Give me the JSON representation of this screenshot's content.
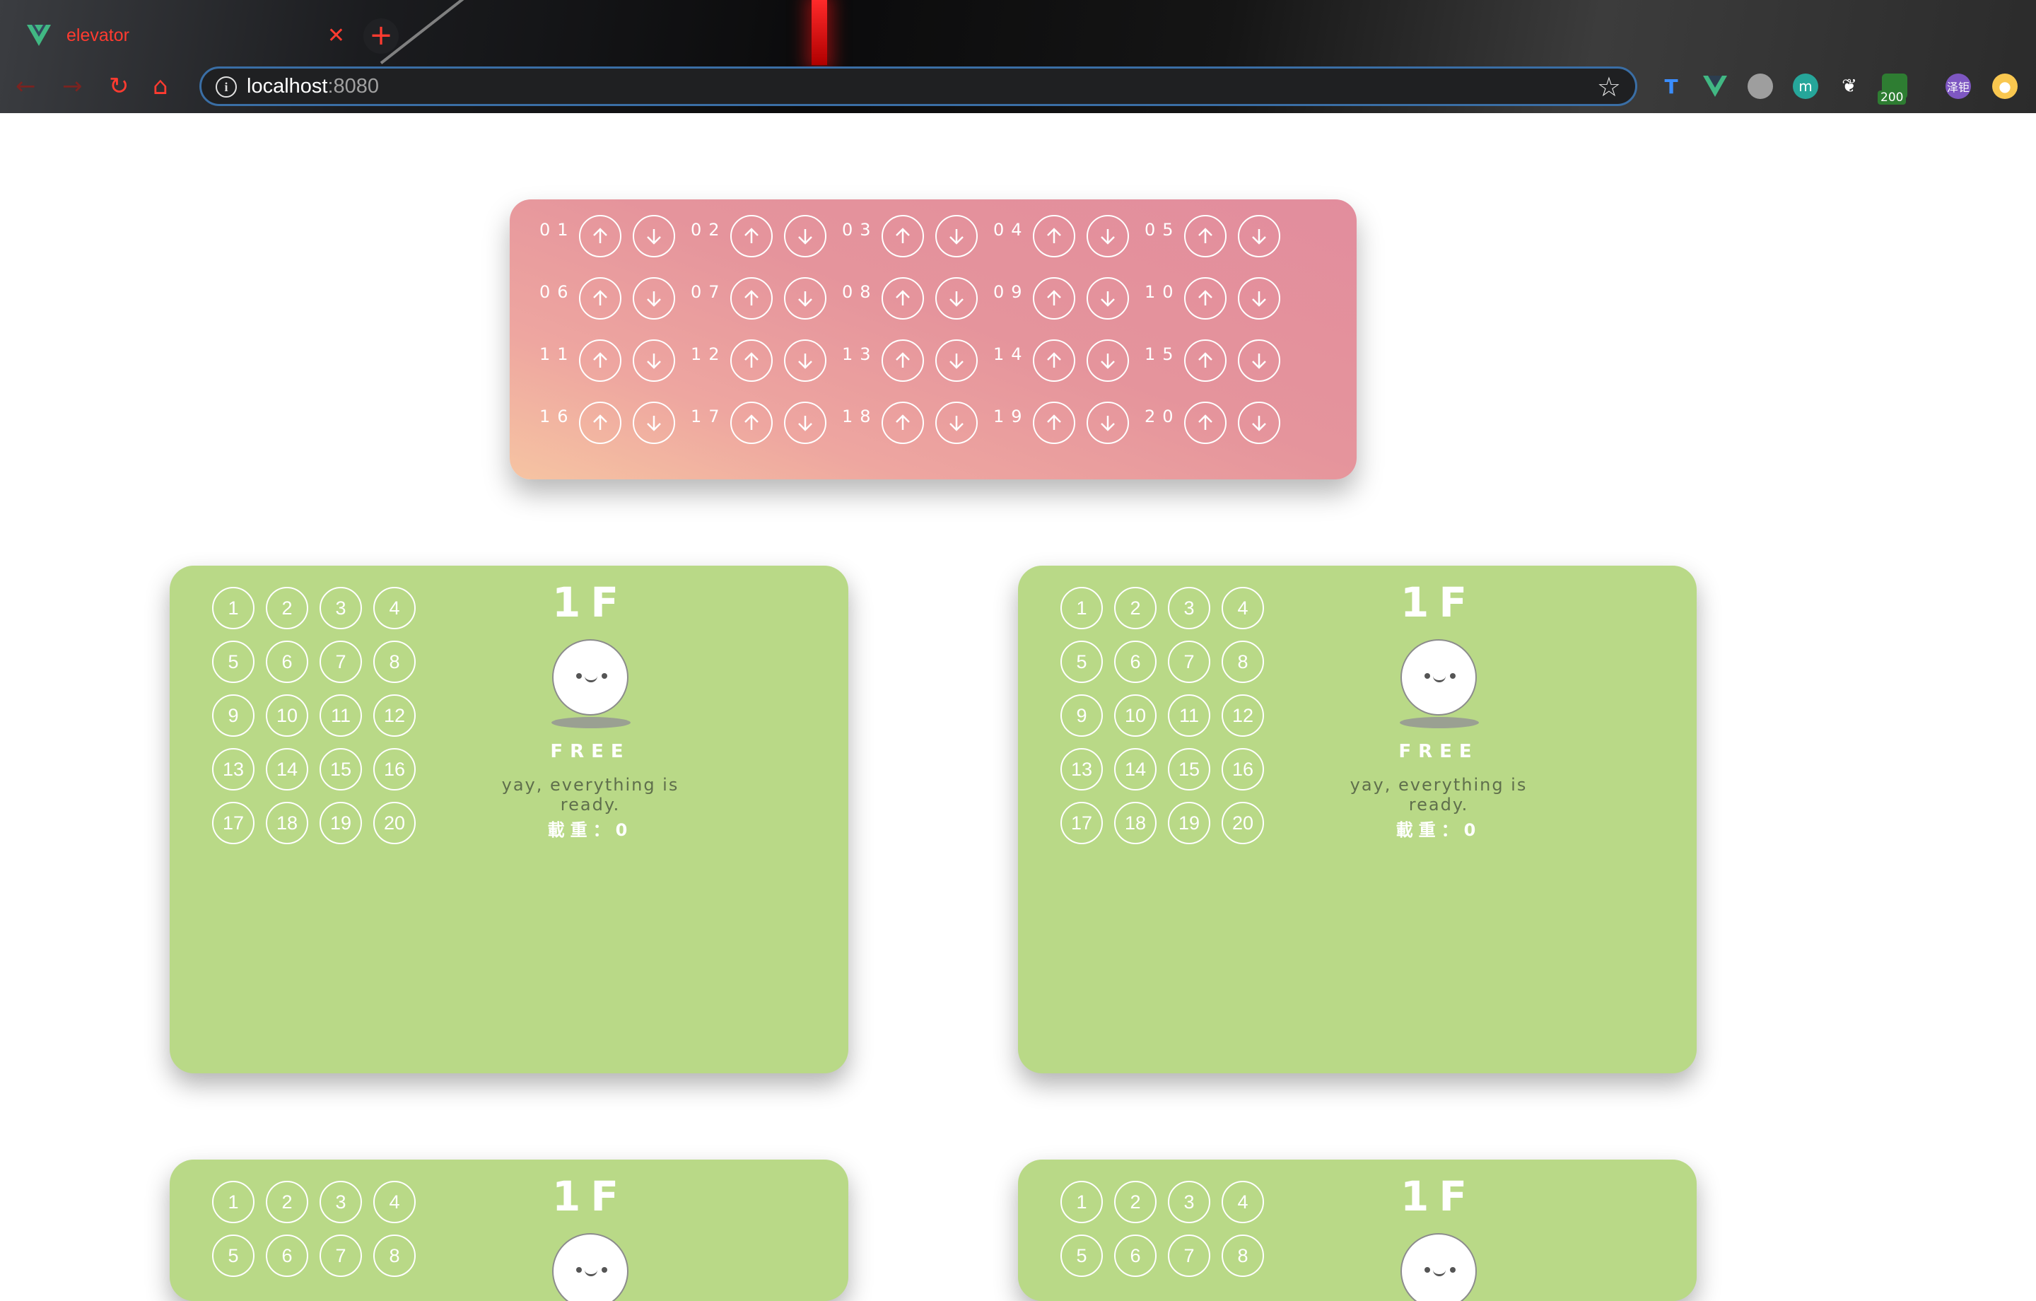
{
  "browser": {
    "tab_title": "elevator",
    "tab_close": "✕",
    "new_tab": "+",
    "url_host": "localhost",
    "url_port": ":8080",
    "extensions": [
      "tampermonkey-icon",
      "vue-devtools-icon",
      "circle-ext-icon",
      "m-ext-icon",
      "gitee-icon",
      "counter-ext-icon",
      "avatar-icon",
      "notification-icon"
    ],
    "ext_badge": "200",
    "avatar_text": "泽钜"
  },
  "call_panel": {
    "floors": [
      "01",
      "02",
      "03",
      "04",
      "05",
      "06",
      "07",
      "08",
      "09",
      "10",
      "11",
      "12",
      "13",
      "14",
      "15",
      "16",
      "17",
      "18",
      "19",
      "20"
    ]
  },
  "cars": [
    {
      "floor_display": "1F",
      "status": "FREE",
      "message": "yay, everything is ready.",
      "load_label": "載重：",
      "load_value": "0",
      "keys": [
        "1",
        "2",
        "3",
        "4",
        "5",
        "6",
        "7",
        "8",
        "9",
        "10",
        "11",
        "12",
        "13",
        "14",
        "15",
        "16",
        "17",
        "18",
        "19",
        "20"
      ]
    },
    {
      "floor_display": "1F",
      "status": "FREE",
      "message": "yay, everything is ready.",
      "load_label": "載重：",
      "load_value": "0",
      "keys": [
        "1",
        "2",
        "3",
        "4",
        "5",
        "6",
        "7",
        "8",
        "9",
        "10",
        "11",
        "12",
        "13",
        "14",
        "15",
        "16",
        "17",
        "18",
        "19",
        "20"
      ]
    },
    {
      "floor_display": "1F",
      "keys": [
        "1",
        "2",
        "3",
        "4",
        "5",
        "6",
        "7",
        "8"
      ]
    },
    {
      "floor_display": "1F",
      "keys": [
        "1",
        "2",
        "3",
        "4",
        "5",
        "6",
        "7",
        "8"
      ]
    }
  ],
  "colors": {
    "accent_red": "#ff3b30",
    "panel_gradient_top": "#e28d9d",
    "panel_gradient_bottom": "#f6c4a2",
    "car_green": "#b9d987"
  }
}
